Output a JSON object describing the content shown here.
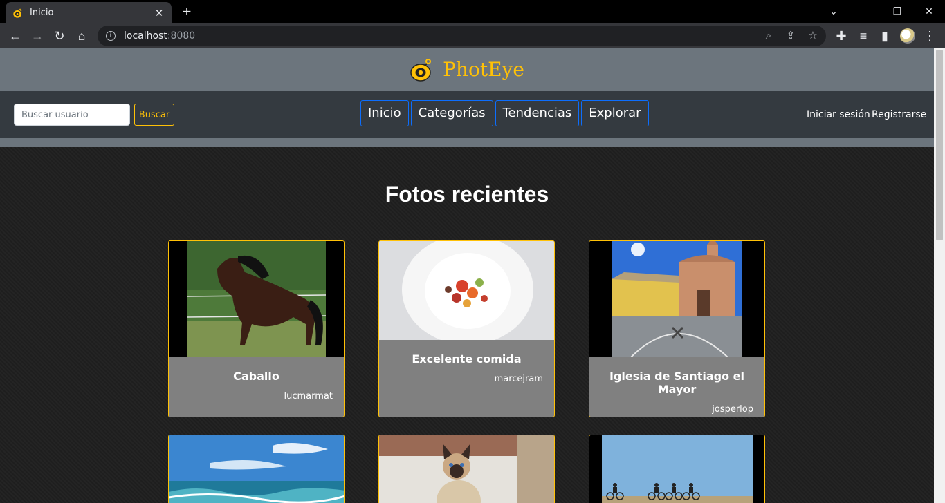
{
  "browser": {
    "tab_title": "Inicio",
    "url_host": "localhost",
    "url_port": ":8080"
  },
  "site": {
    "brand": "PhotEye",
    "accent_color": "#ffc107",
    "search_placeholder": "Buscar usuario",
    "search_button": "Buscar",
    "nav": [
      "Inicio",
      "Categorías",
      "Tendencias",
      "Explorar"
    ],
    "login": "Iniciar sesión",
    "register": "Registrarse"
  },
  "section_title": "Fotos recientes",
  "photos": [
    {
      "title": "Caballo",
      "author": "lucmarmat",
      "image": "horse-photo"
    },
    {
      "title": "Excelente comida",
      "author": "marcejram",
      "image": "food-plate-photo"
    },
    {
      "title": "Iglesia de Santiago el Mayor",
      "author": "josperlop",
      "image": "church-photo"
    },
    {
      "title": "",
      "author": "",
      "image": "sea-waves-photo"
    },
    {
      "title": "",
      "author": "",
      "image": "siamese-cat-photo"
    },
    {
      "title": "",
      "author": "",
      "image": "cyclists-photo"
    }
  ]
}
